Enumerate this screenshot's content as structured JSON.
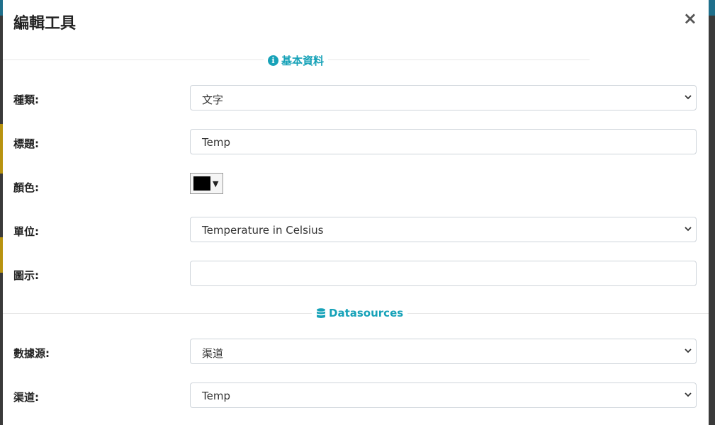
{
  "modal": {
    "title": "編輯工具",
    "close_label": "×"
  },
  "sections": {
    "basic": {
      "label": "基本資料",
      "icon": "info-circle-icon"
    },
    "datasources": {
      "label": "Datasources",
      "icon": "database-icon"
    }
  },
  "fields": {
    "type": {
      "label": "種類:",
      "value": "文字"
    },
    "title": {
      "label": "標題:",
      "value": "Temp"
    },
    "color": {
      "label": "顏色:",
      "value": "#000000"
    },
    "unit": {
      "label": "單位:",
      "value": "Temperature in Celsius"
    },
    "icon": {
      "label": "圖示:",
      "value": ""
    },
    "datasource": {
      "label": "數據源:",
      "value": "渠道"
    },
    "channel": {
      "label": "渠道:",
      "value": "Temp"
    }
  },
  "colors": {
    "accent": "#17a2b8"
  }
}
